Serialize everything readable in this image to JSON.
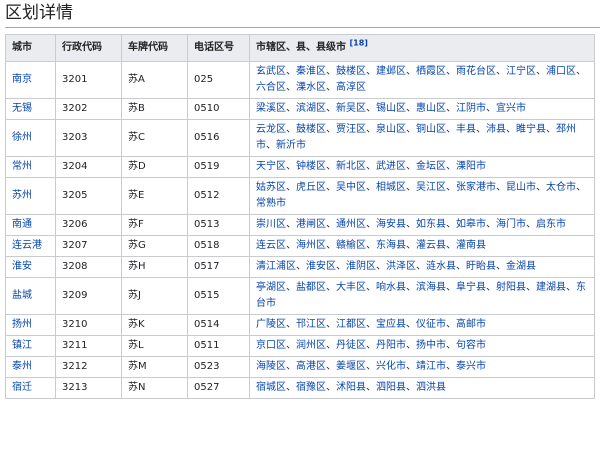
{
  "section_title": "区划详情",
  "headers": {
    "city": "城市",
    "admin_code": "行政代码",
    "plate_code": "车牌代码",
    "area_code": "电话区号",
    "districts": "市辖区、县、县级市",
    "ref": "[18]"
  },
  "rows": [
    {
      "city": "南京",
      "admin_code": "3201",
      "plate": "苏A",
      "area_code": "025",
      "districts": [
        "玄武区",
        "秦淮区",
        "鼓楼区",
        "建邺区",
        "栖霞区",
        "雨花台区",
        "江宁区",
        "浦口区",
        "六合区",
        "溧水区",
        "高淳区"
      ]
    },
    {
      "city": "无锡",
      "admin_code": "3202",
      "plate": "苏B",
      "area_code": "0510",
      "districts": [
        "梁溪区",
        "滨湖区",
        "新吴区",
        "锡山区",
        "惠山区",
        "江阴市",
        "宜兴市"
      ]
    },
    {
      "city": "徐州",
      "admin_code": "3203",
      "plate": "苏C",
      "area_code": "0516",
      "districts": [
        "云龙区",
        "鼓楼区",
        "贾汪区",
        "泉山区",
        "铜山区",
        "丰县",
        "沛县",
        "睢宁县",
        "邳州市",
        "新沂市"
      ]
    },
    {
      "city": "常州",
      "admin_code": "3204",
      "plate": "苏D",
      "area_code": "0519",
      "districts": [
        "天宁区",
        "钟楼区",
        "新北区",
        "武进区",
        "金坛区",
        "溧阳市"
      ]
    },
    {
      "city": "苏州",
      "admin_code": "3205",
      "plate": "苏E",
      "area_code": "0512",
      "districts": [
        "姑苏区",
        "虎丘区",
        "吴中区",
        "相城区",
        "吴江区",
        "张家港市",
        "昆山市",
        "太仓市",
        "常熟市"
      ]
    },
    {
      "city": "南通",
      "admin_code": "3206",
      "plate": "苏F",
      "area_code": "0513",
      "districts": [
        "崇川区",
        "港闸区",
        "通州区",
        "海安县",
        "如东县",
        "如皋市",
        "海门市",
        "启东市"
      ]
    },
    {
      "city": "连云港",
      "admin_code": "3207",
      "plate": "苏G",
      "area_code": "0518",
      "districts": [
        "连云区",
        "海州区",
        "赣榆区",
        "东海县",
        "灌云县",
        "灌南县"
      ]
    },
    {
      "city": "淮安",
      "admin_code": "3208",
      "plate": "苏H",
      "area_code": "0517",
      "districts": [
        "清江浦区",
        "淮安区",
        "淮阴区",
        "洪泽区",
        "涟水县",
        "盱眙县",
        "金湖县"
      ]
    },
    {
      "city": "盐城",
      "admin_code": "3209",
      "plate": "苏J",
      "area_code": "0515",
      "districts": [
        "亭湖区",
        "盐都区",
        "大丰区",
        "响水县",
        "滨海县",
        "阜宁县",
        "射阳县",
        "建湖县",
        "东台市"
      ]
    },
    {
      "city": "扬州",
      "admin_code": "3210",
      "plate": "苏K",
      "area_code": "0514",
      "districts": [
        "广陵区",
        "邗江区",
        "江都区",
        "宝应县",
        "仪征市",
        "高邮市"
      ]
    },
    {
      "city": "镇江",
      "admin_code": "3211",
      "plate": "苏L",
      "area_code": "0511",
      "districts": [
        "京口区",
        "润州区",
        "丹徒区",
        "丹阳市",
        "扬中市",
        "句容市"
      ]
    },
    {
      "city": "泰州",
      "admin_code": "3212",
      "plate": "苏M",
      "area_code": "0523",
      "districts": [
        "海陵区",
        "高港区",
        "姜堰区",
        "兴化市",
        "靖江市",
        "泰兴市"
      ]
    },
    {
      "city": "宿迁",
      "admin_code": "3213",
      "plate": "苏N",
      "area_code": "0527",
      "districts": [
        "宿城区",
        "宿豫区",
        "沭阳县",
        "泗阳县",
        "泗洪县"
      ]
    }
  ],
  "colors": {
    "link": "#0645ad",
    "header_bg": "#eaecf0",
    "border": "#c8ccd1"
  }
}
